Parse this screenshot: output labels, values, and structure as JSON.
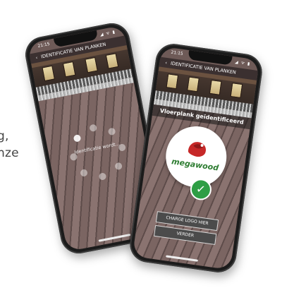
{
  "background_text": [
    "g,",
    "nze",
    "."
  ],
  "left_phone": {
    "status": {
      "time": "21:15",
      "icons": "◢ ᯤ ▮"
    },
    "header": {
      "back_icon": "‹",
      "title": "IDENTIFICATIE VAN PLANKEN"
    },
    "loading_label": "Identificatie wordt..."
  },
  "right_phone": {
    "status": {
      "time": "21:15",
      "icons": "◢ ᯤ ▮"
    },
    "header": {
      "back_icon": "‹",
      "title": "IDENTIFICATIE VAN PLANKEN"
    },
    "result_title": "Vloerplank geïdentificeerd",
    "brand_name": "megawood",
    "check_icon": "✓",
    "buttons": [
      "CHARGE LOGO HIER",
      "VERDER"
    ]
  },
  "colors": {
    "brand_green": "#2e7d32",
    "check_green": "#2e9e45",
    "header_dark": "#3b3030"
  }
}
